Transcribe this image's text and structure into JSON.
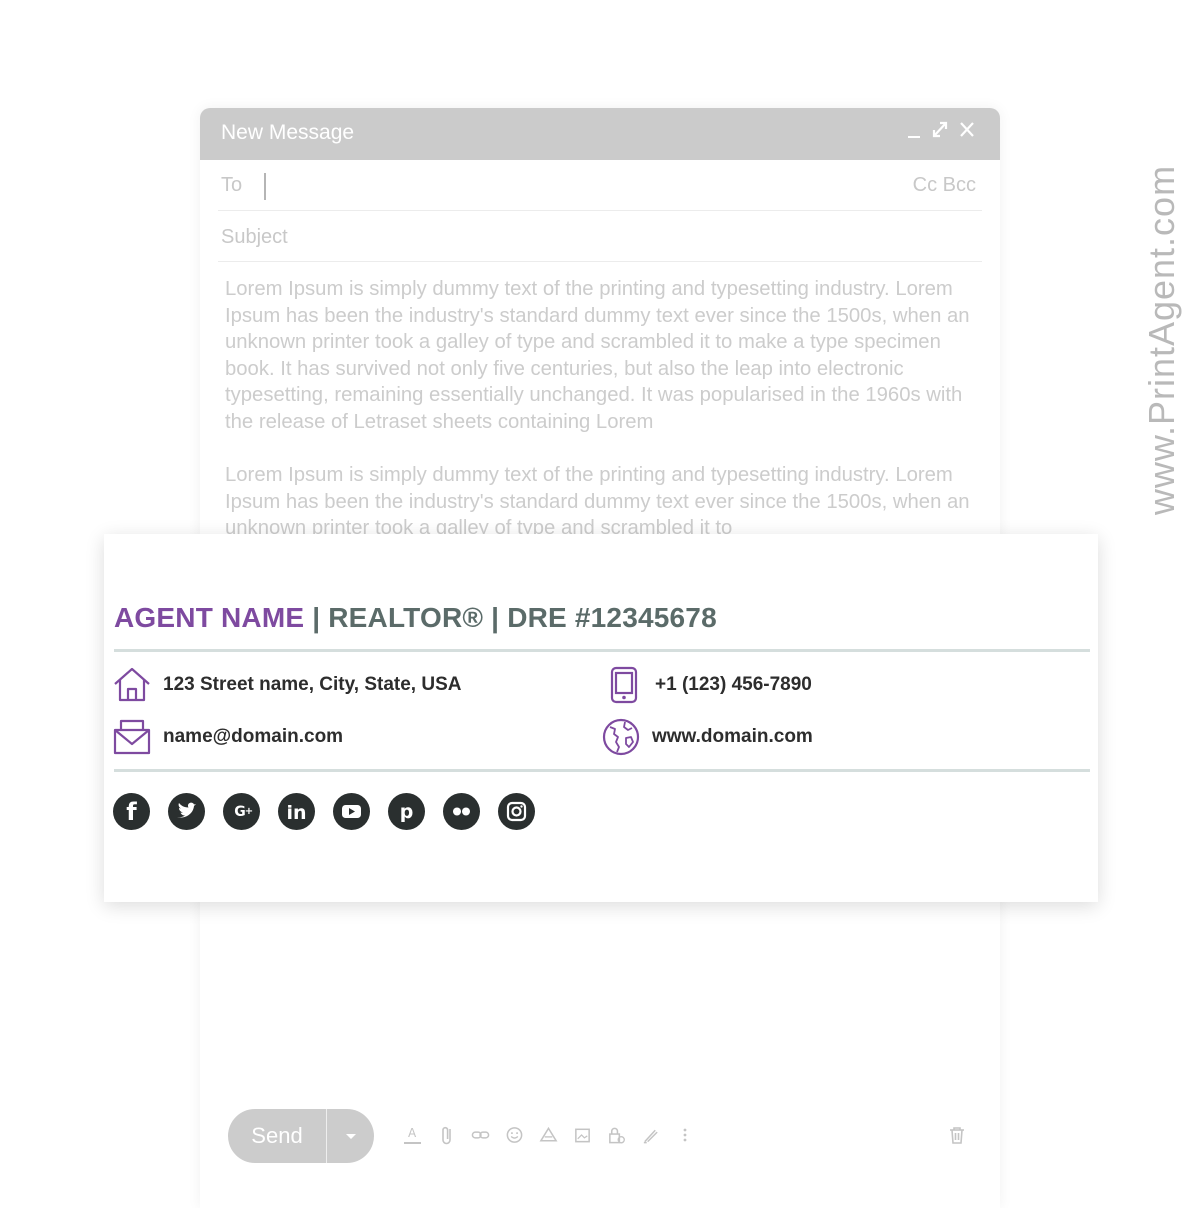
{
  "compose": {
    "title": "New Message",
    "to_label": "To",
    "cc_bcc": "Cc Bcc",
    "subject_placeholder": "Subject",
    "body_paragraphs": [
      "Lorem Ipsum is simply dummy text of the printing and typesetting industry. Lorem Ipsum has been the industry's standard dummy text ever since the 1500s, when an unknown printer took a galley of type and scrambled it to make a type specimen book. It has survived not only five centuries, but also the leap into electronic typesetting, remaining essentially unchanged. It was popularised in the 1960s with the release of Letraset sheets containing Lorem",
      "Lorem Ipsum is simply dummy text of the printing and typesetting industry. Lorem Ipsum has been the industry's standard dummy text ever since the 1500s, when an unknown printer took a galley of type and scrambled it to"
    ],
    "send_label": "Send",
    "toolbar_icons": [
      "text-format-icon",
      "attach-icon",
      "link-icon",
      "emoji-icon",
      "drive-icon",
      "image-icon",
      "confidential-lock-icon",
      "signature-pen-icon",
      "more-options-icon"
    ],
    "window_controls": [
      "minimize-icon",
      "expand-icon",
      "close-icon"
    ]
  },
  "signature": {
    "agent_name": "AGENT NAME",
    "title_rest": " | REALTOR® | DRE #12345678",
    "address": "123 Street name, City, State, USA",
    "phone": "+1 (123) 456-7890",
    "email": "name@domain.com",
    "website": "www.domain.com",
    "social_icons": [
      "facebook-icon",
      "twitter-icon",
      "google-plus-icon",
      "linkedin-icon",
      "youtube-icon",
      "pinterest-icon",
      "flickr-icon",
      "instagram-icon"
    ]
  },
  "colors": {
    "accent_purple": "#7e4aa0",
    "slate_text": "#5b6b69",
    "title_bar": "#cbcbcb",
    "social_bg": "#2a2f2f"
  },
  "watermark": "www.PrintAgent.com"
}
